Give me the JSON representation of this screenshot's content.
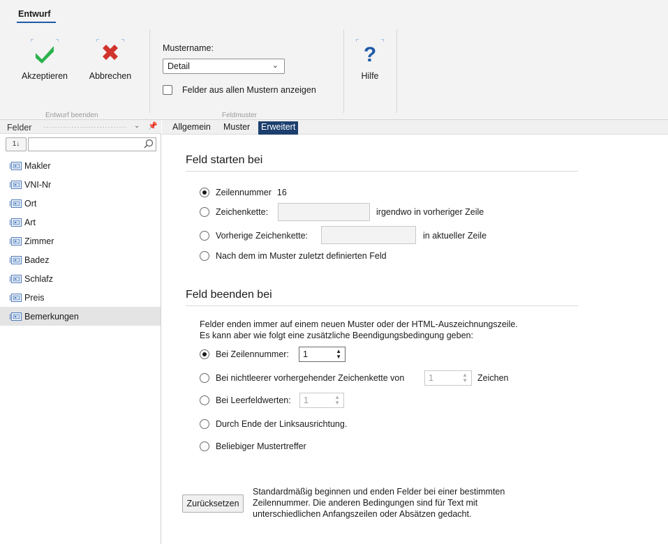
{
  "ribbon": {
    "tab_label": "Entwurf",
    "accept_label": "Akzeptieren",
    "cancel_label": "Abbrechen",
    "group1_caption": "Entwurf beenden",
    "mustername_label": "Mustername:",
    "mustername_value": "Detail",
    "all_fields_label": "Felder aus allen Mustern anzeigen",
    "group2_caption": "Feldmuster",
    "help_label": "Hilfe",
    "accent_check": "#2bb24c",
    "accent_cross": "#d0342c",
    "accent_help": "#1f5aa6"
  },
  "left_pane": {
    "title": "Felder",
    "sort_icon": "sort-icon",
    "sort_label": "1↓",
    "search_icon": "search-icon",
    "items": [
      {
        "label": "Makler"
      },
      {
        "label": "VNI-Nr"
      },
      {
        "label": "Ort"
      },
      {
        "label": "Art"
      },
      {
        "label": "Zimmer"
      },
      {
        "label": "Badez"
      },
      {
        "label": "Schlafz"
      },
      {
        "label": "Preis"
      },
      {
        "label": "Bemerkungen",
        "selected": true
      }
    ]
  },
  "tabs": [
    {
      "label": "Allgemein"
    },
    {
      "label": "Muster"
    },
    {
      "label": "Erweitert",
      "active": true
    }
  ],
  "start": {
    "title": "Feld starten bei",
    "opt_line_label": "Zeilennummer",
    "opt_line_value": "16",
    "opt_string_label": "Zeichenkette:",
    "opt_string_suffix": "irgendwo in vorheriger Zeile",
    "opt_prev_label": "Vorherige Zeichenkette:",
    "opt_prev_suffix": "in aktueller Zeile",
    "opt_after_label": "Nach dem im Muster zuletzt definierten Feld"
  },
  "end": {
    "title": "Feld beenden bei",
    "desc_line1": "Felder enden immer auf einem neuen Muster oder der HTML-Auszeichnungszeile.",
    "desc_line2": "Es kann aber wie folgt eine zusätzliche Beendigungsbedingung geben:",
    "opt_line_label": "Bei Zeilennummer:",
    "opt_line_value": "1",
    "opt_nonempty_label": "Bei nichtleerer vorhergehender Zeichenkette von",
    "opt_nonempty_value": "1",
    "opt_nonempty_suffix": "Zeichen",
    "opt_empty_label": "Bei Leerfeldwerten:",
    "opt_empty_value": "1",
    "opt_align_label": "Durch Ende der Linksausrichtung.",
    "opt_any_label": "Beliebiger Mustertreffer"
  },
  "reset": {
    "button_label": "Zurücksetzen",
    "help_line1": "Standardmäßig beginnen und enden Felder bei einer bestimmten",
    "help_line2": "Zeilennummer. Die anderen Bedingungen sind für Text mit",
    "help_line3": "unterschiedlichen Anfangszeilen oder Absätzen gedacht."
  }
}
